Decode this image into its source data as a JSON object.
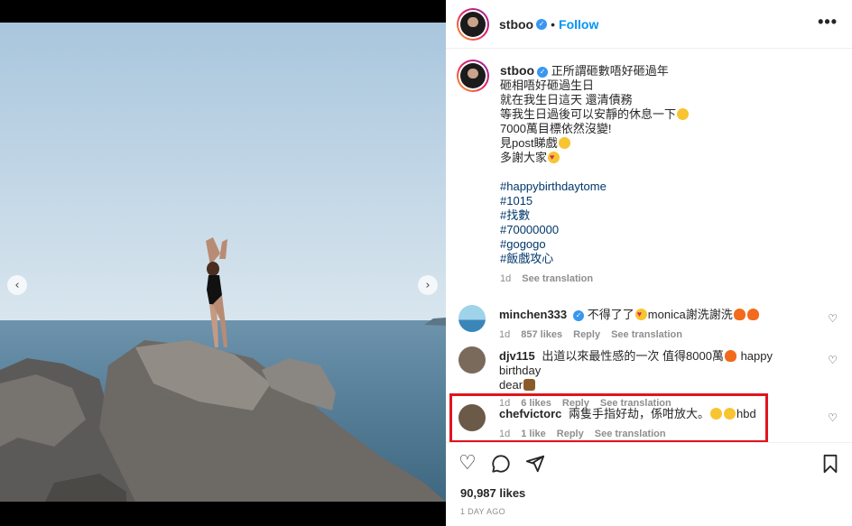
{
  "post": {
    "username": "stboo",
    "follow_label": "Follow",
    "dot": "•",
    "more_label": "•••",
    "verified_mark": "✓"
  },
  "media": {
    "prev_label": "‹",
    "next_label": "›",
    "slide_count": 6,
    "active_slide": 3
  },
  "caption": {
    "username": "stboo",
    "lines": [
      "正所謂砸數唔好砸過年",
      "砸相唔好砸過生日",
      "就在我生日這天 還清債務",
      "等我生日過後可以安靜的休息一下",
      "7000萬目標依然沒變!",
      "見post睇戲",
      "多謝大家"
    ],
    "hashtags": [
      "#happybirthdaytome",
      "#1015",
      "#找數",
      "#70000000",
      "#gogogo",
      "#飯戲攻心"
    ],
    "time": "1d",
    "see_translation": "See translation"
  },
  "comments": [
    {
      "username": "minchen333",
      "text": "不得了了",
      "text2": "monica謝洗謝洗",
      "time": "1d",
      "likes": "857 likes",
      "reply": "Reply",
      "see_translation": "See translation"
    },
    {
      "username": "djv115",
      "text": "出道以來最性感的一次 值得8000萬",
      "text2": "happy birthday",
      "text3": "dear",
      "time": "1d",
      "likes": "6 likes",
      "reply": "Reply",
      "see_translation": "See translation"
    },
    {
      "username": "chefvictorc",
      "text": "兩隻手指好劫，係咁放大。",
      "text2": "hbd",
      "time": "1d",
      "likes": "1 like",
      "reply": "Reply",
      "see_translation": "See translation"
    }
  ],
  "actions": {
    "like_icon": "heart-icon",
    "comment_icon": "comment-icon",
    "share_icon": "share-icon",
    "save_icon": "bookmark-icon",
    "likes_count": "90,987 likes",
    "time_ago": "1 DAY AGO"
  },
  "colors": {
    "link": "#0095f6",
    "hashtag": "#00376b",
    "highlight": "#e0141e",
    "muted": "#8e8e8e"
  }
}
